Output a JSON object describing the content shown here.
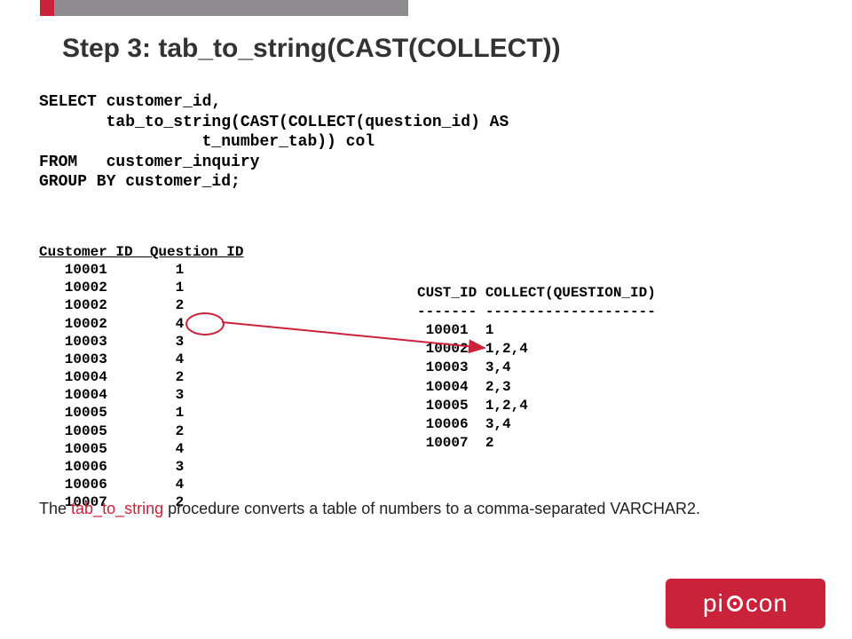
{
  "title": "Step 3: tab_to_string(CAST(COLLECT))",
  "sql": {
    "l1": "SELECT customer_id,",
    "l2": "       tab_to_string(CAST(COLLECT(question_id) AS",
    "l3": "                 t_number_tab)) col",
    "l4": "FROM   customer_inquiry",
    "l5": "GROUP BY customer_id;"
  },
  "leftTable": {
    "header": "Customer_ID  Question_ID",
    "rows": [
      "   10001        1",
      "   10002        1",
      "   10002        2",
      "   10002        4",
      "   10003        3",
      "   10003        4",
      "   10004        2",
      "   10004        3",
      "   10005        1",
      "   10005        2",
      "   10005        4",
      "   10006        3",
      "   10006        4",
      "   10007        2"
    ]
  },
  "rightTable": {
    "header1": "CUST_ID COLLECT(QUESTION_ID)",
    "header2": "------- --------------------",
    "rows": [
      " 10001  1",
      " 10002  1,2,4",
      " 10003  3,4",
      " 10004  2,3",
      " 10005  1,2,4",
      " 10006  3,4",
      " 10007  2"
    ]
  },
  "caption": {
    "prefix": "The ",
    "hl": "tab_to_string",
    "rest": " procedure converts a table of numbers to a comma-separated VARCHAR2."
  },
  "logo": {
    "p1": "pi",
    "p2": "con"
  },
  "colors": {
    "accent": "#c9223a",
    "topbar": "#8e8c8f"
  },
  "chart_data": {
    "type": "table",
    "input_rows": [
      {
        "customer_id": 10001,
        "question_id": 1
      },
      {
        "customer_id": 10002,
        "question_id": 1
      },
      {
        "customer_id": 10002,
        "question_id": 2
      },
      {
        "customer_id": 10002,
        "question_id": 4
      },
      {
        "customer_id": 10003,
        "question_id": 3
      },
      {
        "customer_id": 10003,
        "question_id": 4
      },
      {
        "customer_id": 10004,
        "question_id": 2
      },
      {
        "customer_id": 10004,
        "question_id": 3
      },
      {
        "customer_id": 10005,
        "question_id": 1
      },
      {
        "customer_id": 10005,
        "question_id": 2
      },
      {
        "customer_id": 10005,
        "question_id": 4
      },
      {
        "customer_id": 10006,
        "question_id": 3
      },
      {
        "customer_id": 10006,
        "question_id": 4
      },
      {
        "customer_id": 10007,
        "question_id": 2
      }
    ],
    "output_rows": [
      {
        "cust_id": 10001,
        "collect_question_id": "1"
      },
      {
        "cust_id": 10002,
        "collect_question_id": "1,2,4"
      },
      {
        "cust_id": 10003,
        "collect_question_id": "3,4"
      },
      {
        "cust_id": 10004,
        "collect_question_id": "2,3"
      },
      {
        "cust_id": 10005,
        "collect_question_id": "1,2,4"
      },
      {
        "cust_id": 10006,
        "collect_question_id": "3,4"
      },
      {
        "cust_id": 10007,
        "collect_question_id": "2"
      }
    ]
  }
}
